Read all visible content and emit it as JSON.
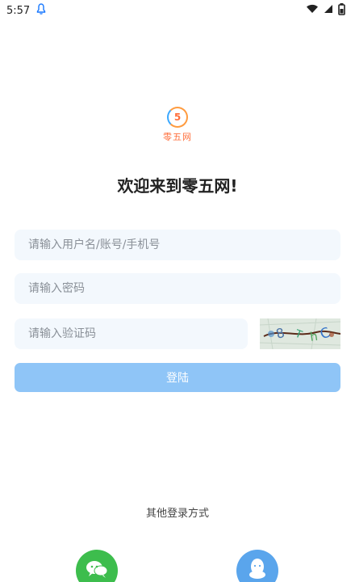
{
  "status_bar": {
    "time": "5:57",
    "icons": [
      "notification-icon",
      "wifi-icon",
      "cellular-signal-icon",
      "battery-icon"
    ]
  },
  "logo": {
    "mark": "5",
    "text": "零五网"
  },
  "welcome": {
    "title": "欢迎来到零五网!"
  },
  "login_form": {
    "username_placeholder": "请输入用户名/账号/手机号",
    "password_placeholder": "请输入密码",
    "captcha_placeholder": "请输入验证码",
    "captcha_image_icon": "captcha-image",
    "login_button": "登陆"
  },
  "other_login": {
    "label": "其他登录方式",
    "providers": [
      {
        "name": "wechat-icon",
        "color": "#3DBD4D"
      },
      {
        "name": "qq-icon",
        "color": "#5AA5EC"
      }
    ]
  },
  "colors": {
    "primary": "#8FC5F7",
    "input_background": "#F3F8FD",
    "text": "#222222",
    "placeholder": "#8A9098",
    "logo_orange": "#FF6F3C",
    "logo_blue": "#3AA8FF"
  }
}
